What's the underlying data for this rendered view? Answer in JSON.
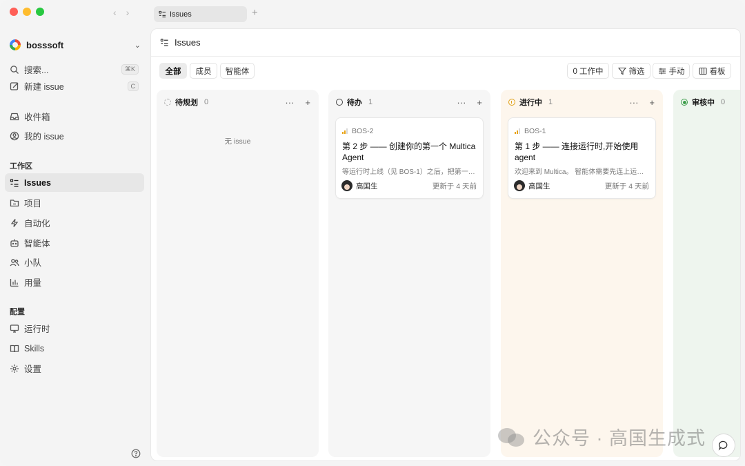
{
  "tabbar": {
    "tab_label": "Issues",
    "add_tab": "+"
  },
  "sidebar": {
    "workspace_name": "bosssoft",
    "search_label": "搜索...",
    "search_shortcut": "⌘K",
    "new_issue_label": "新建 issue",
    "new_issue_shortcut": "C",
    "inbox_label": "收件箱",
    "my_issues_label": "我的 issue",
    "workspace_section": "工作区",
    "workspace_items": [
      "Issues",
      "项目",
      "自动化",
      "智能体",
      "小队",
      "用量"
    ],
    "config_section": "配置",
    "config_items": [
      "运行时",
      "Skills",
      "设置"
    ]
  },
  "main": {
    "title": "Issues",
    "filters": [
      "全部",
      "成员",
      "智能体"
    ],
    "working_label": "0 工作中",
    "filter_label": "筛选",
    "sort_label": "手动",
    "view_label": "看板"
  },
  "columns": [
    {
      "title": "待规划",
      "count": "0",
      "empty_text": "无 issue"
    },
    {
      "title": "待办",
      "count": "1"
    },
    {
      "title": "进行中",
      "count": "1"
    },
    {
      "title": "审核中",
      "count": "0"
    }
  ],
  "cards": [
    {
      "id": "BOS-2",
      "title": "第 2 步 —— 创建你的第一个 Multica Agent",
      "desc": "等运行时上线（见 BOS-1）之后，把第一…",
      "assignee": "高国生",
      "updated": "更新于 4 天前"
    },
    {
      "id": "BOS-1",
      "title": "第 1 步 —— 连接运行时,开始使用 agent",
      "desc": "欢迎来到 Multica。 智能体需要先连上运…",
      "assignee": "高国生",
      "updated": "更新于 4 天前"
    }
  ],
  "watermark": "公众号 · 高国生成式",
  "colors": {
    "in_progress": "#e0a21a",
    "in_review": "#3f9e4d",
    "priority": "#e8a317"
  }
}
